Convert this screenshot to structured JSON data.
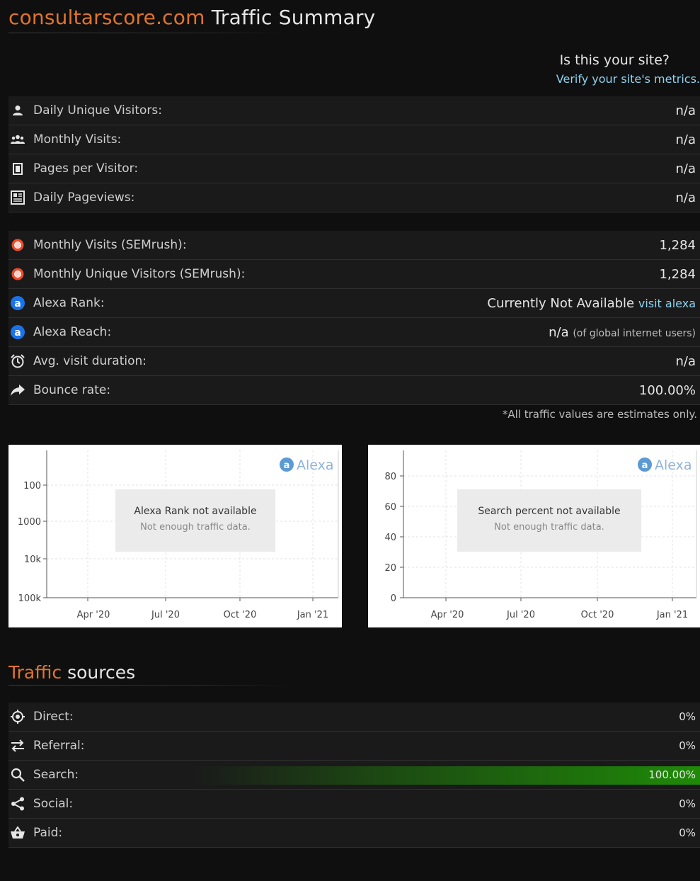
{
  "header": {
    "site": "consultarscore.com",
    "title": "Traffic Summary",
    "claim_question": "Is this your site?",
    "claim_link": "Verify your site's metrics."
  },
  "metrics": [
    {
      "icon": "user-icon",
      "label": "Daily Unique Visitors:",
      "value": "n/a"
    },
    {
      "icon": "users-icon",
      "label": "Monthly Visits:",
      "value": "n/a"
    },
    {
      "icon": "page-icon",
      "label": "Pages per Visitor:",
      "value": "n/a"
    },
    {
      "icon": "newspaper-icon",
      "label": "Daily Pageviews:",
      "value": "n/a"
    }
  ],
  "metrics2": [
    {
      "icon": "semrush-icon",
      "label": "Monthly Visits (SEMrush):",
      "value": "1,284"
    },
    {
      "icon": "semrush-icon",
      "label": "Monthly Unique Visitors (SEMrush):",
      "value": "1,284"
    },
    {
      "icon": "alexa-icon",
      "label": "Alexa Rank:",
      "value": "Currently Not Available",
      "link": "visit alexa"
    },
    {
      "icon": "alexa-icon",
      "label": "Alexa Reach:",
      "value": "n/a",
      "suffix": "(of global internet users)"
    },
    {
      "icon": "alarm-clock-icon",
      "label": "Avg. visit duration:",
      "value": "n/a"
    },
    {
      "icon": "share-arrow-icon",
      "label": "Bounce rate:",
      "value": "100.00%"
    }
  ],
  "note": "*All traffic values are estimates only.",
  "charts": [
    {
      "brand": "Alexa",
      "message": "Alexa Rank not available",
      "submessage": "Not enough traffic data.",
      "yticks": [
        "100",
        "1000",
        "10k",
        "100k"
      ],
      "xticks": [
        "Apr '20",
        "Jul '20",
        "Oct '20",
        "Jan '21"
      ]
    },
    {
      "brand": "Alexa",
      "message": "Search percent not available",
      "submessage": "Not enough traffic data.",
      "yticks": [
        "80",
        "60",
        "40",
        "20",
        "0"
      ],
      "xticks": [
        "Apr '20",
        "Jul '20",
        "Oct '20",
        "Jan '21"
      ]
    }
  ],
  "sources": {
    "title_hl": "Traffic",
    "title": "sources",
    "items": [
      {
        "icon": "target-icon",
        "label": "Direct:",
        "value": "0%",
        "share": 0
      },
      {
        "icon": "exchange-icon",
        "label": "Referral:",
        "value": "0%",
        "share": 0
      },
      {
        "icon": "search-icon",
        "label": "Search:",
        "value": "100.00%",
        "share": 100
      },
      {
        "icon": "share-icon",
        "label": "Social:",
        "value": "0%",
        "share": 0
      },
      {
        "icon": "basket-icon",
        "label": "Paid:",
        "value": "0%",
        "share": 0
      }
    ]
  },
  "colors": {
    "accent": "#e0742c",
    "link": "#8fd3f0",
    "bar": "#1f8a08"
  }
}
